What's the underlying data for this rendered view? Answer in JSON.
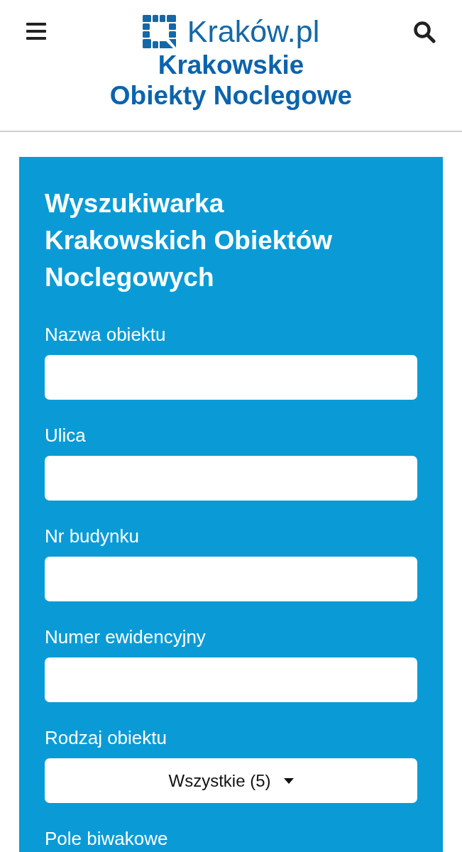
{
  "header": {
    "logo_text": "Kraków.pl",
    "site_title_lines": [
      "Krakowskie",
      "Obiekty Noclegowe"
    ]
  },
  "search_panel": {
    "title": "Wyszukiwarka Krakowskich Obiektów Noclegowych",
    "fields": [
      {
        "kind": "text",
        "label": "Nazwa obiektu"
      },
      {
        "kind": "text",
        "label": "Ulica"
      },
      {
        "kind": "text",
        "label": "Nr budynku"
      },
      {
        "kind": "text",
        "label": "Numer ewidencyjny"
      },
      {
        "kind": "select",
        "label": "Rodzaj obiektu",
        "value": "Wszystkie (5)"
      },
      {
        "kind": "label",
        "label": "Pole biwakowe"
      }
    ]
  }
}
